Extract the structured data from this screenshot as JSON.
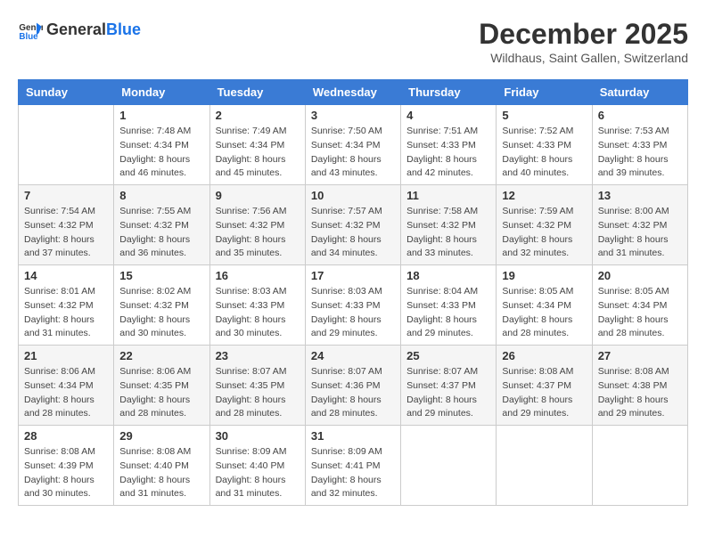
{
  "header": {
    "logo_line1": "General",
    "logo_line2": "Blue",
    "month_year": "December 2025",
    "location": "Wildhaus, Saint Gallen, Switzerland"
  },
  "days_of_week": [
    "Sunday",
    "Monday",
    "Tuesday",
    "Wednesday",
    "Thursday",
    "Friday",
    "Saturday"
  ],
  "weeks": [
    [
      {
        "day": "",
        "sunrise": "",
        "sunset": "",
        "daylight": ""
      },
      {
        "day": "1",
        "sunrise": "Sunrise: 7:48 AM",
        "sunset": "Sunset: 4:34 PM",
        "daylight": "Daylight: 8 hours and 46 minutes."
      },
      {
        "day": "2",
        "sunrise": "Sunrise: 7:49 AM",
        "sunset": "Sunset: 4:34 PM",
        "daylight": "Daylight: 8 hours and 45 minutes."
      },
      {
        "day": "3",
        "sunrise": "Sunrise: 7:50 AM",
        "sunset": "Sunset: 4:34 PM",
        "daylight": "Daylight: 8 hours and 43 minutes."
      },
      {
        "day": "4",
        "sunrise": "Sunrise: 7:51 AM",
        "sunset": "Sunset: 4:33 PM",
        "daylight": "Daylight: 8 hours and 42 minutes."
      },
      {
        "day": "5",
        "sunrise": "Sunrise: 7:52 AM",
        "sunset": "Sunset: 4:33 PM",
        "daylight": "Daylight: 8 hours and 40 minutes."
      },
      {
        "day": "6",
        "sunrise": "Sunrise: 7:53 AM",
        "sunset": "Sunset: 4:33 PM",
        "daylight": "Daylight: 8 hours and 39 minutes."
      }
    ],
    [
      {
        "day": "7",
        "sunrise": "Sunrise: 7:54 AM",
        "sunset": "Sunset: 4:32 PM",
        "daylight": "Daylight: 8 hours and 37 minutes."
      },
      {
        "day": "8",
        "sunrise": "Sunrise: 7:55 AM",
        "sunset": "Sunset: 4:32 PM",
        "daylight": "Daylight: 8 hours and 36 minutes."
      },
      {
        "day": "9",
        "sunrise": "Sunrise: 7:56 AM",
        "sunset": "Sunset: 4:32 PM",
        "daylight": "Daylight: 8 hours and 35 minutes."
      },
      {
        "day": "10",
        "sunrise": "Sunrise: 7:57 AM",
        "sunset": "Sunset: 4:32 PM",
        "daylight": "Daylight: 8 hours and 34 minutes."
      },
      {
        "day": "11",
        "sunrise": "Sunrise: 7:58 AM",
        "sunset": "Sunset: 4:32 PM",
        "daylight": "Daylight: 8 hours and 33 minutes."
      },
      {
        "day": "12",
        "sunrise": "Sunrise: 7:59 AM",
        "sunset": "Sunset: 4:32 PM",
        "daylight": "Daylight: 8 hours and 32 minutes."
      },
      {
        "day": "13",
        "sunrise": "Sunrise: 8:00 AM",
        "sunset": "Sunset: 4:32 PM",
        "daylight": "Daylight: 8 hours and 31 minutes."
      }
    ],
    [
      {
        "day": "14",
        "sunrise": "Sunrise: 8:01 AM",
        "sunset": "Sunset: 4:32 PM",
        "daylight": "Daylight: 8 hours and 31 minutes."
      },
      {
        "day": "15",
        "sunrise": "Sunrise: 8:02 AM",
        "sunset": "Sunset: 4:32 PM",
        "daylight": "Daylight: 8 hours and 30 minutes."
      },
      {
        "day": "16",
        "sunrise": "Sunrise: 8:03 AM",
        "sunset": "Sunset: 4:33 PM",
        "daylight": "Daylight: 8 hours and 30 minutes."
      },
      {
        "day": "17",
        "sunrise": "Sunrise: 8:03 AM",
        "sunset": "Sunset: 4:33 PM",
        "daylight": "Daylight: 8 hours and 29 minutes."
      },
      {
        "day": "18",
        "sunrise": "Sunrise: 8:04 AM",
        "sunset": "Sunset: 4:33 PM",
        "daylight": "Daylight: 8 hours and 29 minutes."
      },
      {
        "day": "19",
        "sunrise": "Sunrise: 8:05 AM",
        "sunset": "Sunset: 4:34 PM",
        "daylight": "Daylight: 8 hours and 28 minutes."
      },
      {
        "day": "20",
        "sunrise": "Sunrise: 8:05 AM",
        "sunset": "Sunset: 4:34 PM",
        "daylight": "Daylight: 8 hours and 28 minutes."
      }
    ],
    [
      {
        "day": "21",
        "sunrise": "Sunrise: 8:06 AM",
        "sunset": "Sunset: 4:34 PM",
        "daylight": "Daylight: 8 hours and 28 minutes."
      },
      {
        "day": "22",
        "sunrise": "Sunrise: 8:06 AM",
        "sunset": "Sunset: 4:35 PM",
        "daylight": "Daylight: 8 hours and 28 minutes."
      },
      {
        "day": "23",
        "sunrise": "Sunrise: 8:07 AM",
        "sunset": "Sunset: 4:35 PM",
        "daylight": "Daylight: 8 hours and 28 minutes."
      },
      {
        "day": "24",
        "sunrise": "Sunrise: 8:07 AM",
        "sunset": "Sunset: 4:36 PM",
        "daylight": "Daylight: 8 hours and 28 minutes."
      },
      {
        "day": "25",
        "sunrise": "Sunrise: 8:07 AM",
        "sunset": "Sunset: 4:37 PM",
        "daylight": "Daylight: 8 hours and 29 minutes."
      },
      {
        "day": "26",
        "sunrise": "Sunrise: 8:08 AM",
        "sunset": "Sunset: 4:37 PM",
        "daylight": "Daylight: 8 hours and 29 minutes."
      },
      {
        "day": "27",
        "sunrise": "Sunrise: 8:08 AM",
        "sunset": "Sunset: 4:38 PM",
        "daylight": "Daylight: 8 hours and 29 minutes."
      }
    ],
    [
      {
        "day": "28",
        "sunrise": "Sunrise: 8:08 AM",
        "sunset": "Sunset: 4:39 PM",
        "daylight": "Daylight: 8 hours and 30 minutes."
      },
      {
        "day": "29",
        "sunrise": "Sunrise: 8:08 AM",
        "sunset": "Sunset: 4:40 PM",
        "daylight": "Daylight: 8 hours and 31 minutes."
      },
      {
        "day": "30",
        "sunrise": "Sunrise: 8:09 AM",
        "sunset": "Sunset: 4:40 PM",
        "daylight": "Daylight: 8 hours and 31 minutes."
      },
      {
        "day": "31",
        "sunrise": "Sunrise: 8:09 AM",
        "sunset": "Sunset: 4:41 PM",
        "daylight": "Daylight: 8 hours and 32 minutes."
      },
      {
        "day": "",
        "sunrise": "",
        "sunset": "",
        "daylight": ""
      },
      {
        "day": "",
        "sunrise": "",
        "sunset": "",
        "daylight": ""
      },
      {
        "day": "",
        "sunrise": "",
        "sunset": "",
        "daylight": ""
      }
    ]
  ]
}
